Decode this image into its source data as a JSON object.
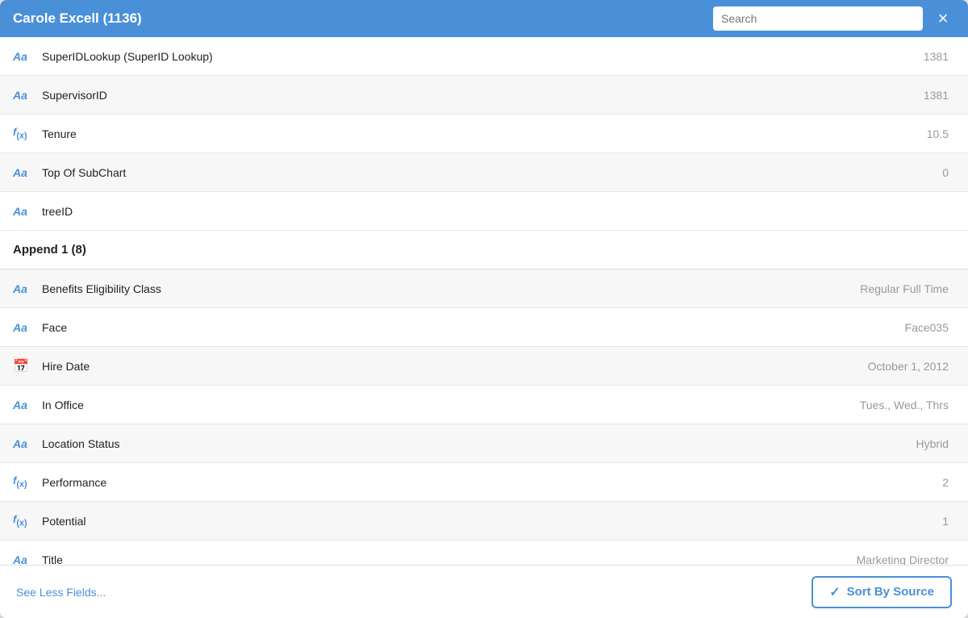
{
  "header": {
    "title": "Carole Excell (1136)",
    "search_placeholder": "Search",
    "close_label": "×"
  },
  "fields": [
    {
      "id": "superid-lookup",
      "icon": "aa",
      "name": "SuperIDLookup (SuperID Lookup)",
      "value": "1381",
      "bg": "white"
    },
    {
      "id": "supervisor-id",
      "icon": "aa",
      "name": "SupervisorID",
      "value": "1381",
      "bg": "gray"
    },
    {
      "id": "tenure",
      "icon": "fx",
      "name": "Tenure",
      "value": "10.5",
      "bg": "white"
    },
    {
      "id": "top-of-subchart",
      "icon": "aa",
      "name": "Top Of SubChart",
      "value": "0",
      "bg": "gray"
    },
    {
      "id": "tree-id",
      "icon": "aa",
      "name": "treeID",
      "value": "",
      "bg": "white"
    }
  ],
  "section": {
    "label": "Append 1 (8)"
  },
  "append_fields": [
    {
      "id": "benefits-eligibility",
      "icon": "aa",
      "name": "Benefits Eligibility Class",
      "value": "Regular Full Time",
      "bg": "gray"
    },
    {
      "id": "face",
      "icon": "aa",
      "name": "Face",
      "value": "Face035",
      "bg": "white"
    },
    {
      "id": "hire-date",
      "icon": "cal",
      "name": "Hire Date",
      "value": "October 1, 2012",
      "bg": "gray"
    },
    {
      "id": "in-office",
      "icon": "aa",
      "name": "In Office",
      "value": "Tues., Wed., Thrs",
      "bg": "white"
    },
    {
      "id": "location-status",
      "icon": "aa",
      "name": "Location Status",
      "value": "Hybrid",
      "bg": "gray"
    },
    {
      "id": "performance",
      "icon": "fx",
      "name": "Performance",
      "value": "2",
      "bg": "white"
    },
    {
      "id": "potential",
      "icon": "fx",
      "name": "Potential",
      "value": "1",
      "bg": "gray"
    },
    {
      "id": "title",
      "icon": "aa",
      "name": "Title",
      "value": "Marketing Director",
      "bg": "white"
    }
  ],
  "footer": {
    "see_less_label": "See Less Fields...",
    "sort_by_source_label": "Sort By Source",
    "sort_checkmark": "✓"
  }
}
